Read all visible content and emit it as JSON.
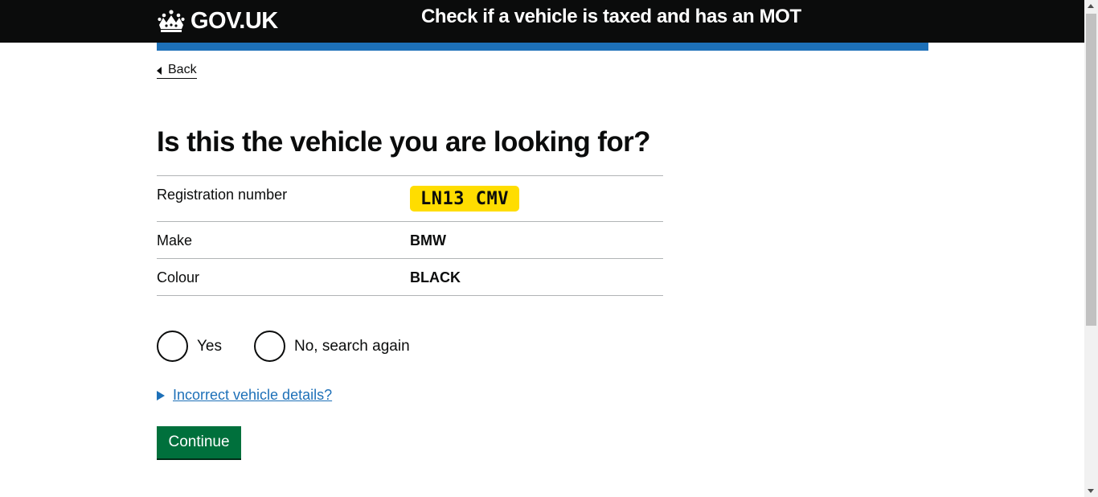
{
  "header": {
    "logo_text": "GOV.UK",
    "service_name": "Check if a vehicle is taxed and has an MOT"
  },
  "back_link": "Back",
  "heading": "Is this the vehicle you are looking for?",
  "summary": {
    "rows": [
      {
        "key": "Registration number",
        "value": "LN13 CMV"
      },
      {
        "key": "Make",
        "value": "BMW"
      },
      {
        "key": "Colour",
        "value": "BLACK"
      }
    ]
  },
  "radios": {
    "yes_label": "Yes",
    "no_label": "No, search again"
  },
  "details_summary": "Incorrect vehicle details?",
  "continue_label": "Continue",
  "colors": {
    "header_bg": "#0b0c0c",
    "brand_blue": "#1d70b8",
    "plate_yellow": "#ffdd00",
    "button_green": "#00703c"
  },
  "icons": {
    "logo": "crown-icon",
    "back": "chevron-left-icon",
    "details": "triangle-right-icon"
  }
}
